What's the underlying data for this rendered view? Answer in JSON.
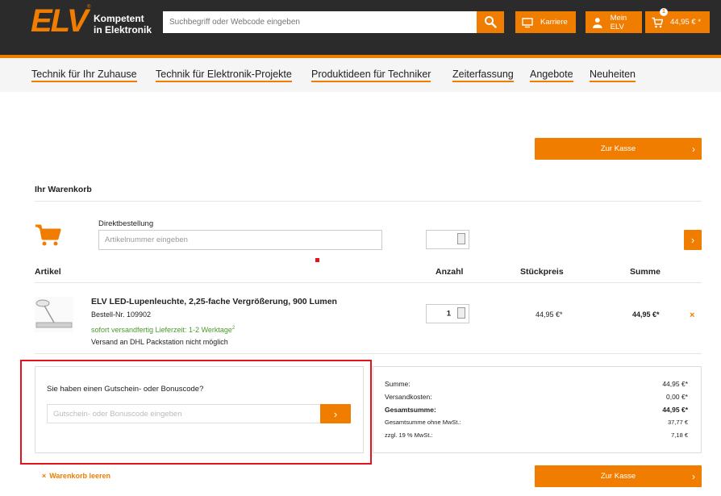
{
  "header": {
    "logo_text": "ELV",
    "logo_reg": "®",
    "tagline_1": "Kompetent",
    "tagline_2": "in Elektronik",
    "search_placeholder": "Suchbegriff oder Webcode eingeben",
    "karriere_label": "Karriere",
    "account_label": "Mein ELV",
    "cart_count": "1",
    "cart_total": "44,95 € *"
  },
  "nav": {
    "items": [
      "Technik für Ihr Zuhause",
      "Technik für Elektronik-Projekte",
      "Produktideen für Techniker",
      "Zeiterfassung",
      "Angebote",
      "Neuheiten"
    ]
  },
  "cart": {
    "checkout_label": "Zur Kasse",
    "title": "Ihr Warenkorb",
    "direct_order_label": "Direktbestellung",
    "direct_order_placeholder": "Artikelnummer eingeben",
    "columns": {
      "article": "Artikel",
      "quantity": "Anzahl",
      "unit_price": "Stückpreis",
      "sum": "Summe"
    },
    "item": {
      "name": "ELV LED-Lupenleuchte, 2,25-fache Vergrößerung, 900 Lumen",
      "order_no": "Bestell-Nr. 109902",
      "availability": "sofort versandfertig Lieferzeit: 1-2 Werktage",
      "availability_note": "2",
      "shipping_note": "Versand an DHL Packstation nicht möglich",
      "quantity": "1",
      "unit_price": "44,95 €*",
      "total": "44,95 €*",
      "remove_icon": "×"
    },
    "voucher": {
      "question": "Sie haben einen Gutschein- oder Bonuscode?",
      "placeholder": "Gutschein- oder Bonuscode eingeben"
    },
    "summary": {
      "subtotal_label": "Summe:",
      "subtotal": "44,95 €*",
      "shipping_label": "Versandkosten:",
      "shipping": "0,00 €*",
      "grand_label": "Gesamtsumme:",
      "grand": "44,95 €*",
      "net_label": "Gesamtsumme ohne MwSt.:",
      "net": "37,77 €",
      "vat_label": "zzgl. 19 % MwSt.:",
      "vat": "7,18 €"
    },
    "clear_label": "Warenkorb leeren"
  },
  "colors": {
    "accent": "#f07d00",
    "header_bg": "#2b2b2b",
    "highlight": "#e3141e",
    "success": "#4a9a2a"
  }
}
